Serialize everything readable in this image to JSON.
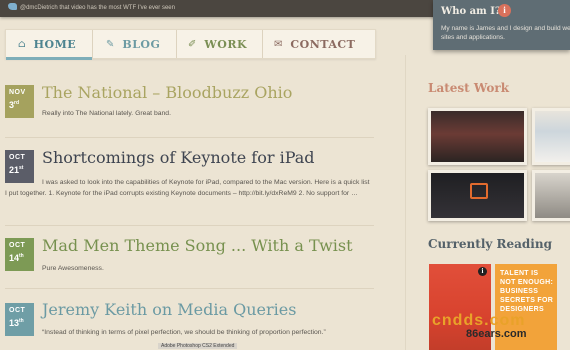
{
  "tweet": {
    "text": "@dmcDietrich that video has the most WTF I've ever seen"
  },
  "about": {
    "title": "Who am I?",
    "info_glyph": "i",
    "text": "My name is James and I design and build web sites and applications."
  },
  "nav": {
    "items": [
      {
        "label": "HOME",
        "icon": "home-icon",
        "glyph": "⌂",
        "color": "#4d8490"
      },
      {
        "label": "BLOG",
        "icon": "pencil-icon",
        "glyph": "✎",
        "color": "#6d9ba3"
      },
      {
        "label": "WORK",
        "icon": "brush-icon",
        "glyph": "✐",
        "color": "#7b8f55"
      },
      {
        "label": "CONTACT",
        "icon": "envelope-icon",
        "glyph": "✉",
        "color": "#8b6a60"
      }
    ]
  },
  "posts": [
    {
      "month": "NOV",
      "day": "3",
      "suffix": "rd",
      "title": "The National – Bloodbuzz Ohio",
      "excerpt": "Really into The National lately. Great band.",
      "date_color": "#a5a25e",
      "title_color": "#a9a461"
    },
    {
      "month": "OCT",
      "day": "21",
      "suffix": "st",
      "title": "Shortcomings of Keynote for iPad",
      "excerpt": "I was asked to look into the capabilities of Keynote for iPad, compared to the Mac version. Here is a quick list I put together. 1. Keynote for the iPad corrupts existing Keynote documents – http://bit.ly/dxReM9 2. No support for …",
      "date_color": "#5b5d68",
      "title_color": "#3e4450"
    },
    {
      "month": "OCT",
      "day": "14",
      "suffix": "th",
      "title": "Mad Men Theme Song ... With a Twist",
      "excerpt": "Pure Awesomeness.",
      "date_color": "#7d9a55",
      "title_color": "#77914f"
    },
    {
      "month": "OCT",
      "day": "13",
      "suffix": "th",
      "title": "Jeremy Keith on Media Queries",
      "excerpt": "“Instead of thinking in terms of pixel perfection, we should be thinking of proportion perfection.”",
      "date_color": "#6f9ea6",
      "title_color": "#6b9aa3"
    }
  ],
  "sidebar": {
    "latest_work": "Latest Work",
    "latest_color": "#c98a72",
    "currently_reading": "Currently Reading",
    "reading_color": "#546169",
    "book2_text": "TALENT IS NOT ENOUGH: BUSINESS SECRETS FOR DESIGNERS"
  },
  "watermark": {
    "main": "cndds.com",
    "sub": "86ears.com"
  },
  "status": "Adobe Photoshop CS2 Extended"
}
